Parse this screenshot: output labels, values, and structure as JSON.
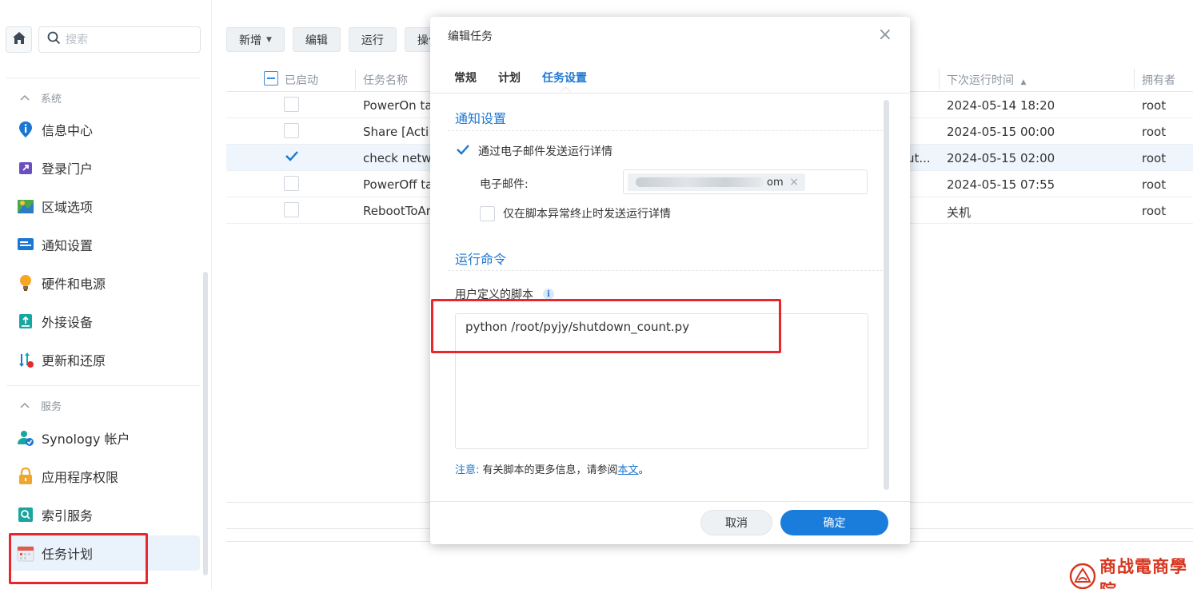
{
  "sidebar": {
    "search_placeholder": "搜索",
    "sections": [
      {
        "label": "系统"
      },
      {
        "label": "服务"
      }
    ],
    "items": [
      {
        "label": "信息中心"
      },
      {
        "label": "登录门户"
      },
      {
        "label": "区域选项"
      },
      {
        "label": "通知设置"
      },
      {
        "label": "硬件和电源"
      },
      {
        "label": "外接设备"
      },
      {
        "label": "更新和还原"
      },
      {
        "label": "Synology 帐户"
      },
      {
        "label": "应用程序权限"
      },
      {
        "label": "索引服务"
      },
      {
        "label": "任务计划"
      }
    ],
    "active_item": "任务计划"
  },
  "toolbar": {
    "add_label": "新增",
    "edit_label": "编辑",
    "run_label": "运行",
    "action_label": "操作"
  },
  "table": {
    "columns": {
      "enabled": "已启动",
      "name": "任务名称",
      "next_run": "下次运行时间",
      "sort_indicator": "▲",
      "owner": "拥有者"
    },
    "rows": [
      {
        "enabled": false,
        "name": "PowerOn ta",
        "action_tail": "",
        "next_run": "2024-05-14 18:20",
        "owner": "root"
      },
      {
        "enabled": false,
        "name": "Share [Acti",
        "action_tail": "",
        "next_run": "2024-05-15 00:00",
        "owner": "root"
      },
      {
        "enabled": true,
        "name": "check netw",
        "action_tail": "ut...",
        "next_run": "2024-05-15 02:00",
        "owner": "root"
      },
      {
        "enabled": false,
        "name": "PowerOff ta",
        "action_tail": "",
        "next_run": "2024-05-15 07:55",
        "owner": "root"
      },
      {
        "enabled": false,
        "name": "RebootToAr",
        "action_tail": "",
        "next_run": "关机",
        "owner": "root"
      }
    ]
  },
  "dialog": {
    "title": "编辑任务",
    "close_glyph": "×",
    "tabs": [
      {
        "label": "常规"
      },
      {
        "label": "计划"
      },
      {
        "label": "任务设置"
      }
    ],
    "active_tab": "任务设置",
    "notify": {
      "title": "通知设置",
      "email_checkbox_label": "通过电子邮件发送运行详情",
      "email_checked": true,
      "email_label": "电子邮件:",
      "email_visible_suffix": "om",
      "chip_remove": "×",
      "abnormal_checkbox_label": "仅在脚本异常终止时发送运行详情",
      "abnormal_checked": false
    },
    "command": {
      "title": "运行命令",
      "script_label": "用户定义的脚本",
      "info_glyph": "i",
      "script": "python /root/pyjy/shutdown_count.py"
    },
    "note": {
      "label": "注意:",
      "text": "有关脚本的更多信息，请参阅",
      "link": "本文",
      "end": "。"
    },
    "cancel_label": "取消",
    "ok_label": "确定"
  },
  "watermark": {
    "text": "商战電商學院"
  },
  "colors": {
    "accent": "#1c77d2",
    "primary_button": "#1a7ddb",
    "highlight_box": "#e8262b",
    "selected_row": "#eef5fc"
  }
}
